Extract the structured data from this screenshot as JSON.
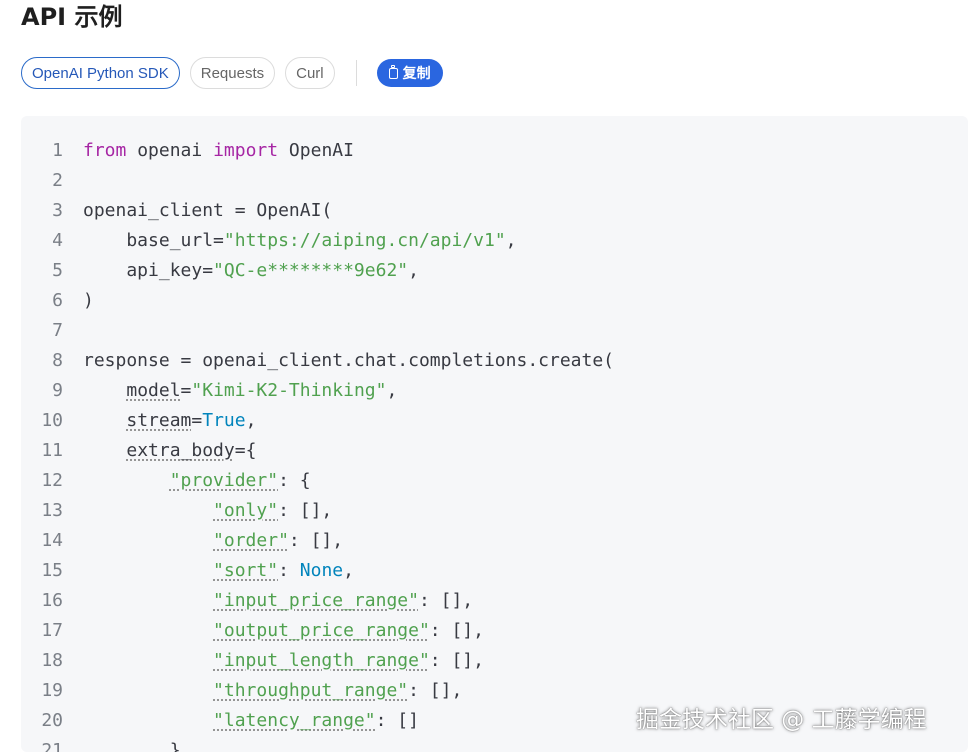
{
  "title": "API 示例",
  "tabs": [
    {
      "label": "OpenAI Python SDK",
      "active": true
    },
    {
      "label": "Requests",
      "active": false
    },
    {
      "label": "Curl",
      "active": false
    }
  ],
  "copy_label": "复制",
  "colors": {
    "accent": "#2a66e0",
    "keyword": "#a626a4",
    "string": "#50a14f",
    "builtin": "#0184bc",
    "line_number": "#7a7f87",
    "code_bg": "#f6f7f9"
  },
  "code": {
    "lines": [
      {
        "n": "1",
        "tokens": [
          {
            "t": "from",
            "c": "kw"
          },
          {
            "t": " openai "
          },
          {
            "t": "import",
            "c": "kw"
          },
          {
            "t": " OpenAI"
          }
        ]
      },
      {
        "n": "2",
        "tokens": []
      },
      {
        "n": "3",
        "tokens": [
          {
            "t": "openai_client = OpenAI("
          }
        ]
      },
      {
        "n": "4",
        "tokens": [
          {
            "t": "    base_url="
          },
          {
            "t": "\"https://aiping.cn/api/v1\"",
            "c": "str"
          },
          {
            "t": ","
          }
        ]
      },
      {
        "n": "5",
        "tokens": [
          {
            "t": "    api_key="
          },
          {
            "t": "\"QC-e********9e62\"",
            "c": "str"
          },
          {
            "t": ","
          }
        ]
      },
      {
        "n": "6",
        "tokens": [
          {
            "t": ")"
          }
        ]
      },
      {
        "n": "7",
        "tokens": []
      },
      {
        "n": "8",
        "tokens": [
          {
            "t": "response = openai_client.chat.completions.create("
          }
        ]
      },
      {
        "n": "9",
        "tokens": [
          {
            "t": "    "
          },
          {
            "t": "model",
            "c": "ul"
          },
          {
            "t": "="
          },
          {
            "t": "\"Kimi-K2-Thinking\"",
            "c": "str"
          },
          {
            "t": ","
          }
        ]
      },
      {
        "n": "10",
        "tokens": [
          {
            "t": "    "
          },
          {
            "t": "stream",
            "c": "ul"
          },
          {
            "t": "="
          },
          {
            "t": "True",
            "c": "bi"
          },
          {
            "t": ","
          }
        ]
      },
      {
        "n": "11",
        "tokens": [
          {
            "t": "    "
          },
          {
            "t": "extra_body",
            "c": "ul"
          },
          {
            "t": "={"
          }
        ]
      },
      {
        "n": "12",
        "tokens": [
          {
            "t": "        "
          },
          {
            "t": "\"provider\"",
            "c": "str ul"
          },
          {
            "t": ": {"
          }
        ]
      },
      {
        "n": "13",
        "tokens": [
          {
            "t": "            "
          },
          {
            "t": "\"only\"",
            "c": "str ul"
          },
          {
            "t": ": [],"
          }
        ]
      },
      {
        "n": "14",
        "tokens": [
          {
            "t": "            "
          },
          {
            "t": "\"order\"",
            "c": "str ul"
          },
          {
            "t": ": [],"
          }
        ]
      },
      {
        "n": "15",
        "tokens": [
          {
            "t": "            "
          },
          {
            "t": "\"sort\"",
            "c": "str ul"
          },
          {
            "t": ": "
          },
          {
            "t": "None",
            "c": "bi"
          },
          {
            "t": ","
          }
        ]
      },
      {
        "n": "16",
        "tokens": [
          {
            "t": "            "
          },
          {
            "t": "\"input_price_range\"",
            "c": "str ul"
          },
          {
            "t": ": [],"
          }
        ]
      },
      {
        "n": "17",
        "tokens": [
          {
            "t": "            "
          },
          {
            "t": "\"output_price_range\"",
            "c": "str ul"
          },
          {
            "t": ": [],"
          }
        ]
      },
      {
        "n": "18",
        "tokens": [
          {
            "t": "            "
          },
          {
            "t": "\"input_length_range\"",
            "c": "str ul"
          },
          {
            "t": ": [],"
          }
        ]
      },
      {
        "n": "19",
        "tokens": [
          {
            "t": "            "
          },
          {
            "t": "\"throughput_range\"",
            "c": "str ul"
          },
          {
            "t": ": [],"
          }
        ]
      },
      {
        "n": "20",
        "tokens": [
          {
            "t": "            "
          },
          {
            "t": "\"latency_range\"",
            "c": "str ul"
          },
          {
            "t": ": []"
          }
        ]
      },
      {
        "n": "21",
        "tokens": [
          {
            "t": "        }"
          }
        ]
      }
    ]
  },
  "watermark": "掘金技术社区 @ 工藤学编程"
}
